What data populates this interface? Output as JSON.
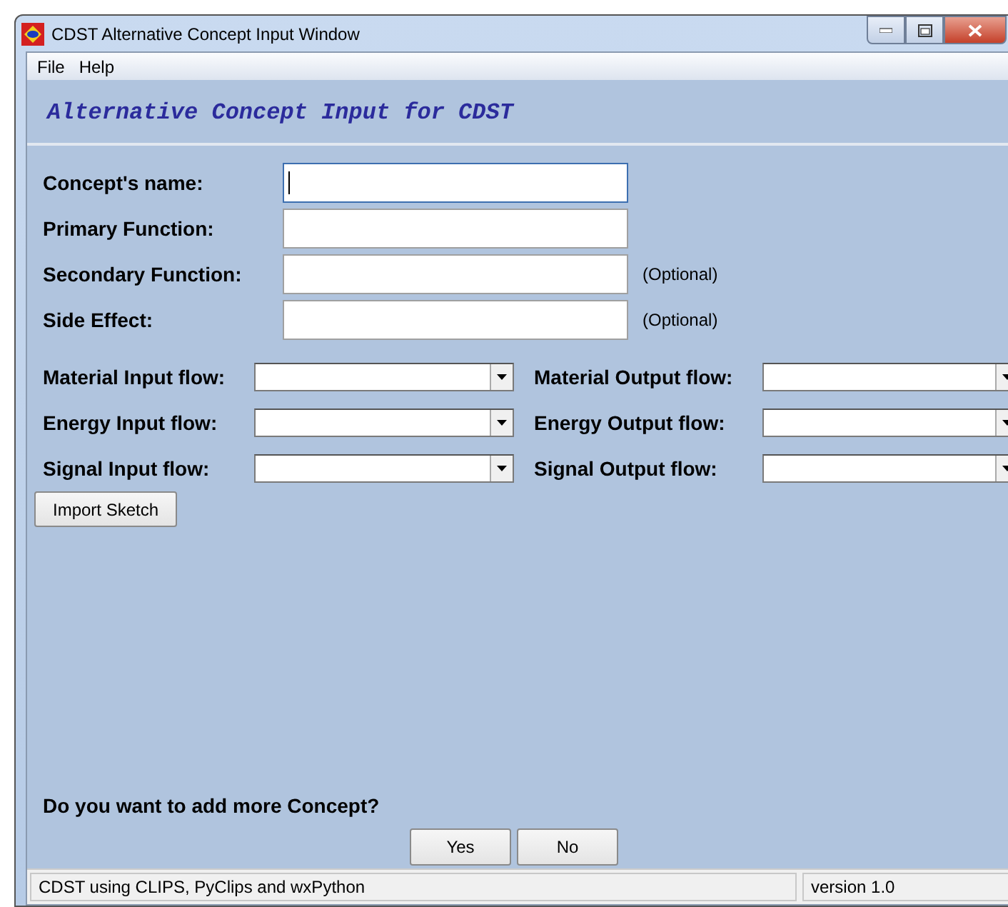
{
  "window": {
    "title": "CDST Alternative Concept Input Window"
  },
  "menu": [
    "File",
    "Help"
  ],
  "heading": "Alternative Concept Input for CDST",
  "fields": [
    {
      "label": "Concept's name:",
      "focused": true
    },
    {
      "label": "Primary Function:",
      "focused": false
    },
    {
      "label": "Secondary Function:",
      "focused": false,
      "note": "(Optional)"
    },
    {
      "label": "Side Effect:",
      "focused": false,
      "note": "(Optional)"
    }
  ],
  "flows": [
    {
      "input_label": "Material Input flow:",
      "output_label": "Material Output flow:"
    },
    {
      "input_label": "Energy Input flow:",
      "output_label": "Energy Output flow:"
    },
    {
      "input_label": "Signal Input flow:",
      "output_label": "Signal Output flow:"
    }
  ],
  "import_button": "Import Sketch",
  "question": "Do you want to add more Concept?",
  "answer_buttons": [
    "Yes",
    "No"
  ],
  "status_bar": [
    "CDST using CLIPS, PyClips and wxPython",
    "version 1.0"
  ]
}
